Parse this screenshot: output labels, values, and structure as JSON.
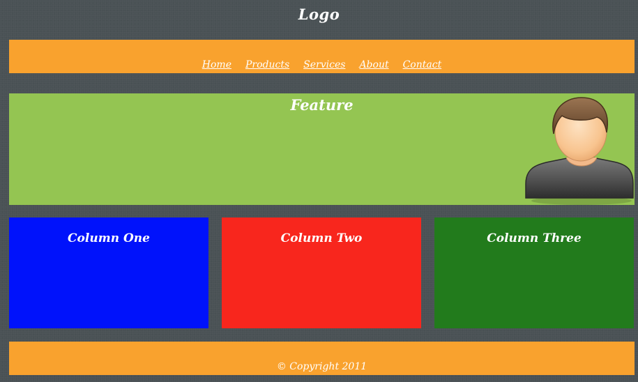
{
  "header": {
    "logo": "Logo"
  },
  "nav": {
    "items": [
      {
        "label": "Home"
      },
      {
        "label": "Products"
      },
      {
        "label": "Services"
      },
      {
        "label": "About"
      },
      {
        "label": "Contact"
      }
    ]
  },
  "feature": {
    "title": "Feature",
    "avatar_icon": "user-avatar-icon"
  },
  "columns": [
    {
      "title": "Column One"
    },
    {
      "title": "Column Two"
    },
    {
      "title": "Column Three"
    }
  ],
  "footer": {
    "copyright": "© Copyright 2011"
  },
  "colors": {
    "page_background": "#4a5255",
    "accent_orange": "#f9a22e",
    "feature_green": "#94c552",
    "column_blue": "#0012fb",
    "column_red": "#f8261d",
    "column_green": "#227b1c",
    "text": "#ffffff"
  }
}
